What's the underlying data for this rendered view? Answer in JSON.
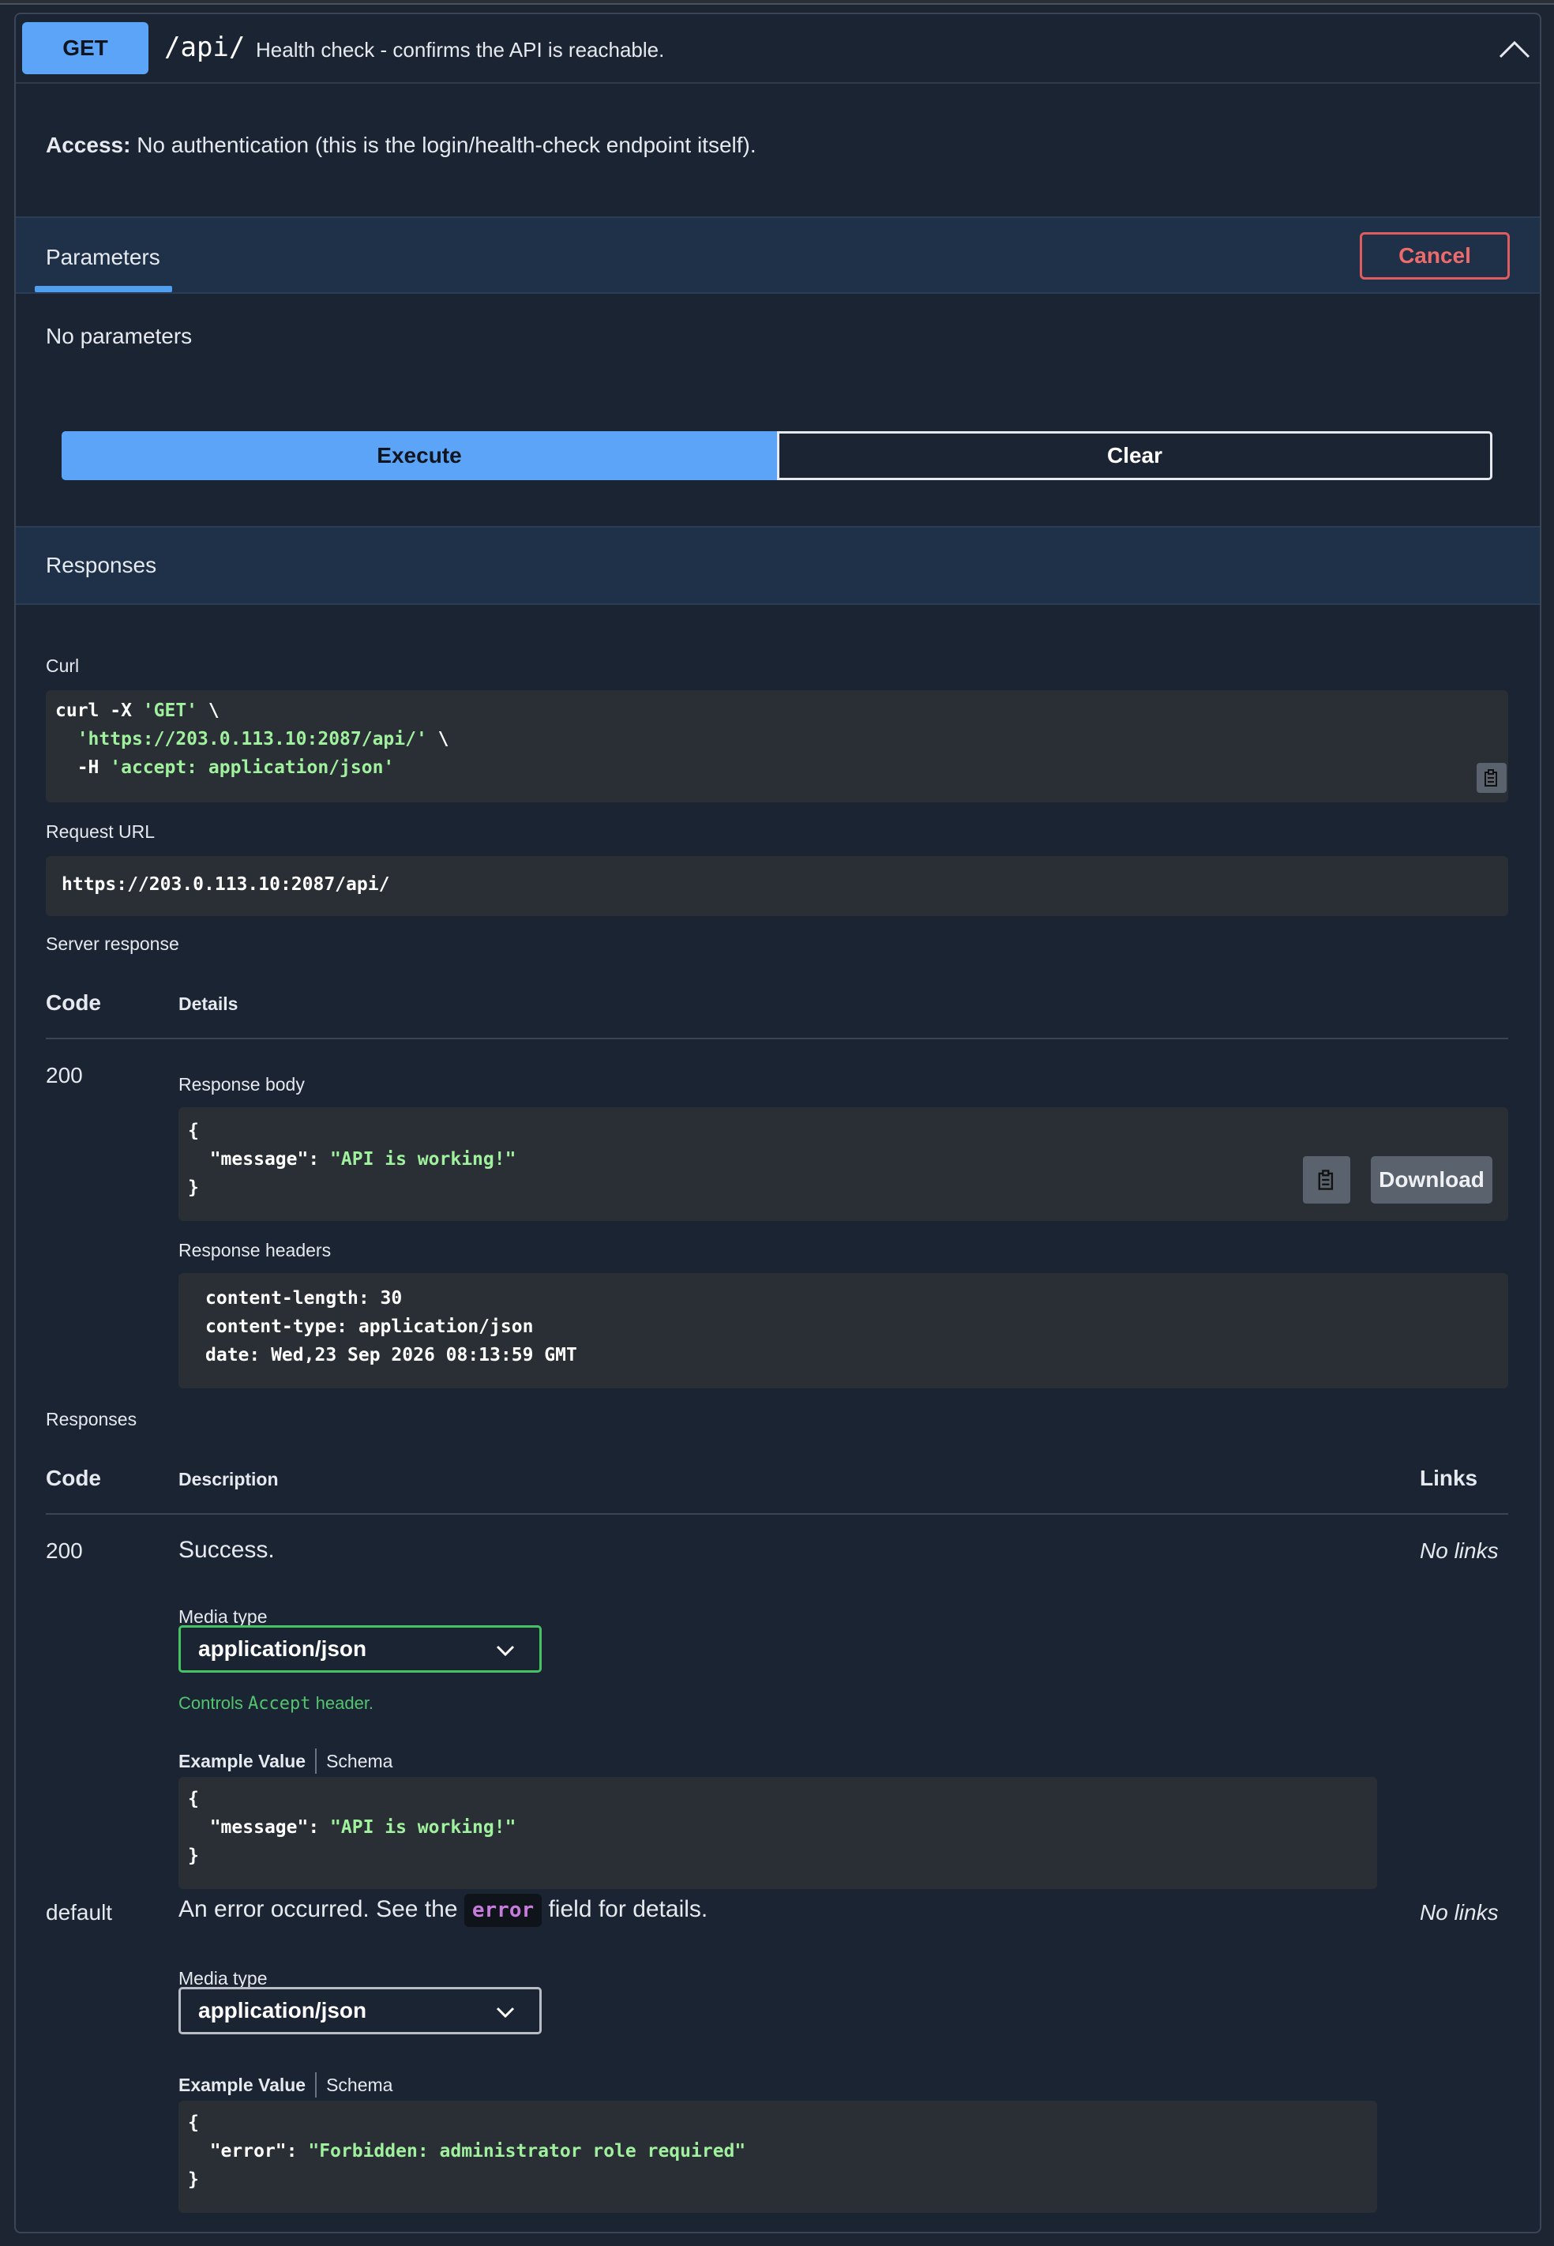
{
  "endpoint": {
    "method": "GET",
    "path": "/api/",
    "summary": "Health check - confirms the API is reachable.",
    "access_label": "Access:",
    "access_text": "No authentication (this is the login/health-check endpoint itself)."
  },
  "parameters": {
    "tab_label": "Parameters",
    "cancel_label": "Cancel",
    "empty_text": "No parameters"
  },
  "actions": {
    "execute_label": "Execute",
    "clear_label": "Clear"
  },
  "responses_header": "Responses",
  "curl": {
    "label": "Curl",
    "line1_cmd": "curl -X ",
    "line1_method": "'GET'",
    "line1_tail": " \\",
    "line2_url": "'https://203.0.113.10:2087/api/'",
    "line2_tail": " \\",
    "line3_flag": "  -H ",
    "line3_header": "'accept: application/json'"
  },
  "request_url": {
    "label": "Request URL",
    "value": "https://203.0.113.10:2087/api/"
  },
  "server_response": {
    "label": "Server response",
    "col_code": "Code",
    "col_details": "Details",
    "code": "200",
    "body_label": "Response body",
    "body_open": "{",
    "body_key": "\"message\"",
    "body_colon": ": ",
    "body_value": "\"API is working!\"",
    "body_close": "}",
    "download_label": "Download",
    "headers_label": "Response headers",
    "headers": [
      "content-length: 30",
      "content-type: application/json",
      "date: Wed,23 Sep 2026 08:13:59 GMT"
    ]
  },
  "responses_table": {
    "label": "Responses",
    "col_code": "Code",
    "col_description": "Description",
    "col_links": "Links",
    "rows": [
      {
        "code": "200",
        "description": "Success.",
        "links": "No links",
        "media_label": "Media type",
        "media_value": "application/json",
        "controls_pre": "Controls ",
        "controls_code": "Accept",
        "controls_post": " header.",
        "tab_example": "Example Value",
        "tab_schema": "Schema",
        "ex_open": "{",
        "ex_key": "\"message\"",
        "ex_colon": ": ",
        "ex_value": "\"API is working!\"",
        "ex_close": "}"
      },
      {
        "code": "default",
        "description_pre": "An error occurred. See the ",
        "description_code": "error",
        "description_post": " field for details.",
        "links": "No links",
        "media_label": "Media type",
        "media_value": "application/json",
        "tab_example": "Example Value",
        "tab_schema": "Schema",
        "ex_open": "{",
        "ex_key": "\"error\"",
        "ex_colon": ": ",
        "ex_value": "\"Forbidden: administrator role required\"",
        "ex_close": "}"
      }
    ]
  },
  "colors": {
    "method_get": "#5ba4f8",
    "cancel": "#e05d5d",
    "string_value": "#a0f19e",
    "select_valid": "#47c262",
    "inline_code": "#c77bdc"
  },
  "icons": [
    "chevron-up-icon",
    "copy-icon",
    "chevron-down-icon"
  ]
}
